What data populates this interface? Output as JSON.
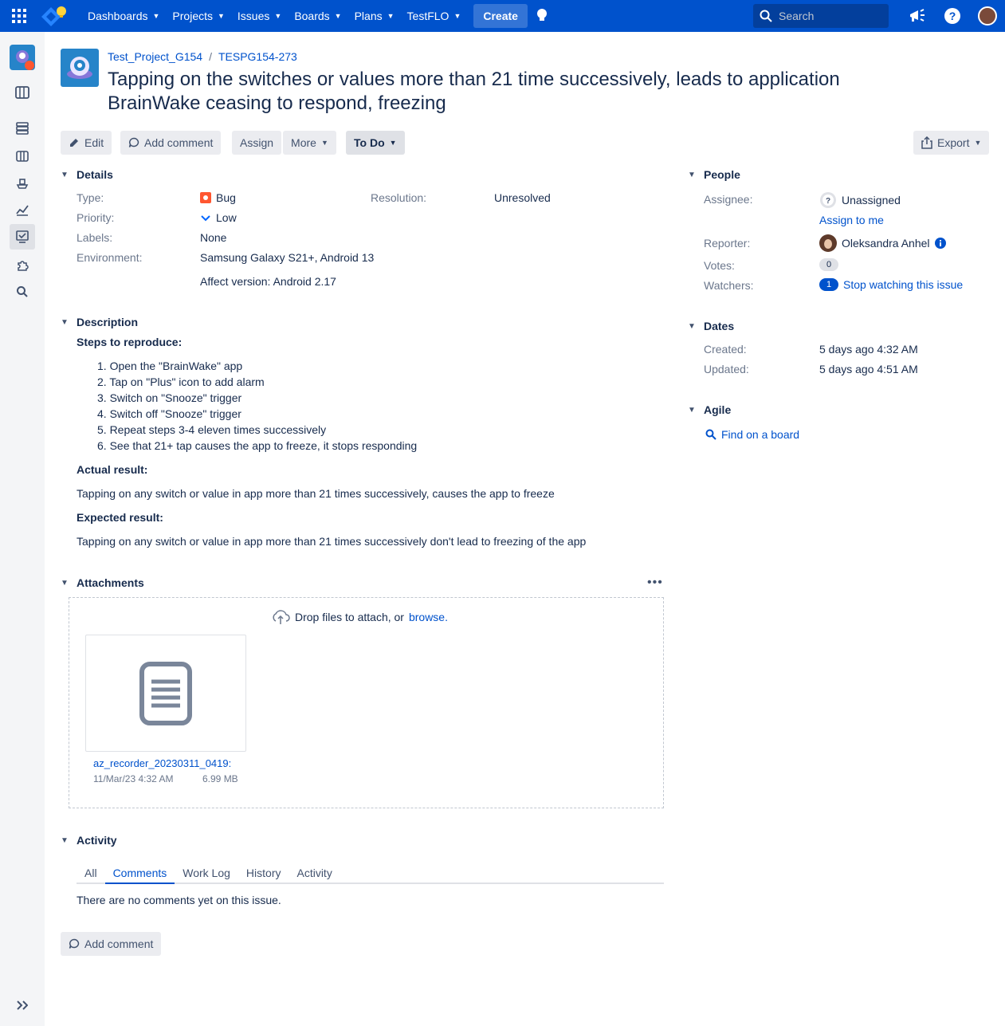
{
  "topnav": {
    "items": [
      {
        "label": "Dashboards"
      },
      {
        "label": "Projects"
      },
      {
        "label": "Issues"
      },
      {
        "label": "Boards"
      },
      {
        "label": "Plans"
      },
      {
        "label": "TestFLO"
      }
    ],
    "create_label": "Create",
    "search_placeholder": "Search",
    "brand_color": "#0052cc"
  },
  "breadcrumb": {
    "project": "Test_Project_G154",
    "issue_key": "TESPG154-273"
  },
  "issue": {
    "title": "Tapping on the switches or values more than 21 time successively, leads to application BrainWake ceasing to respond, freezing"
  },
  "toolbar": {
    "edit": "Edit",
    "add_comment": "Add comment",
    "assign": "Assign",
    "more": "More",
    "status": "To Do",
    "export": "Export"
  },
  "details": {
    "heading": "Details",
    "type_label": "Type:",
    "type_value": "Bug",
    "priority_label": "Priority:",
    "priority_value": "Low",
    "labels_label": "Labels:",
    "labels_value": "None",
    "environment_label": "Environment:",
    "environment_value": "Samsung Galaxy S21+, Android 13",
    "affect_version": "Affect version: Android 2.17",
    "resolution_label": "Resolution:",
    "resolution_value": "Unresolved"
  },
  "description": {
    "heading": "Description",
    "steps_title": "Steps to reproduce:",
    "steps": [
      "1. Open the \"BrainWake\" app",
      "2. Tap on \"Plus\" icon to add alarm",
      "3. Switch on \"Snooze\" trigger",
      "4. Switch off \"Snooze\" trigger",
      "5. Repeat steps 3-4 eleven times successively",
      "6. See that 21+ tap causes the app to freeze, it stops responding"
    ],
    "actual_title": "Actual result:",
    "actual_text": "Tapping on any switch or value in app more than 21 times successively, causes the app to freeze",
    "expected_title": "Expected result:",
    "expected_text": "Tapping on any switch or value in app more than 21 times successively don't lead to freezing of the app"
  },
  "attachments": {
    "heading": "Attachments",
    "drop_text": "Drop files to attach, or",
    "browse": "browse.",
    "file_name": "az_recorder_20230311_0419:",
    "file_date": "11/Mar/23 4:32 AM",
    "file_size": "6.99 MB"
  },
  "activity": {
    "heading": "Activity",
    "tabs": [
      {
        "label": "All"
      },
      {
        "label": "Comments"
      },
      {
        "label": "Work Log"
      },
      {
        "label": "History"
      },
      {
        "label": "Activity"
      }
    ],
    "empty_text": "There are no comments yet on this issue.",
    "add_comment": "Add comment"
  },
  "people": {
    "heading": "People",
    "assignee_label": "Assignee:",
    "assignee_value": "Unassigned",
    "assign_to_me": "Assign to me",
    "reporter_label": "Reporter:",
    "reporter_value": "Oleksandra Anhel",
    "votes_label": "Votes:",
    "votes_value": "0",
    "watchers_label": "Watchers:",
    "watchers_count": "1",
    "watchers_action": "Stop watching this issue"
  },
  "dates": {
    "heading": "Dates",
    "created_label": "Created:",
    "created_value": "5 days ago 4:32 AM",
    "updated_label": "Updated:",
    "updated_value": "5 days ago 4:51 AM"
  },
  "agile": {
    "heading": "Agile",
    "find_on_board": "Find on a board"
  }
}
